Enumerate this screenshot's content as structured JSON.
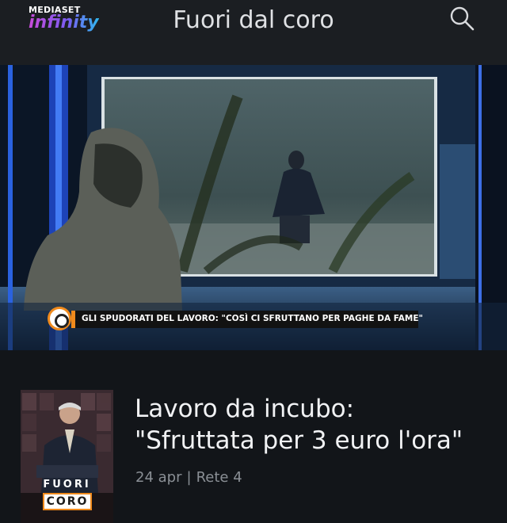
{
  "header": {
    "logo_top": "MEDIASET",
    "logo_bottom": "infinity",
    "title": "Fuori dal coro"
  },
  "hero": {
    "banner_text": "GLI SPUDORATI DEL LAVORO: \"COSÌ CI SFRUTTANO PER PAGHE DA FAME\""
  },
  "episode": {
    "thumb_line1": "FUORI",
    "thumb_line2": "CORO",
    "title_line1": "Lavoro da incubo:",
    "title_line2": "\"Sfruttata per 3 euro l'ora\"",
    "date": "24 apr",
    "separator": "|",
    "channel": "Rete 4"
  },
  "colors": {
    "background": "#121519",
    "header_background": "#1b1e22",
    "accent_orange": "#f08a1c",
    "meta_text": "#8a8f95"
  },
  "icons": {
    "search": "search-icon",
    "program_logo": "fuori-dal-coro-logo"
  }
}
